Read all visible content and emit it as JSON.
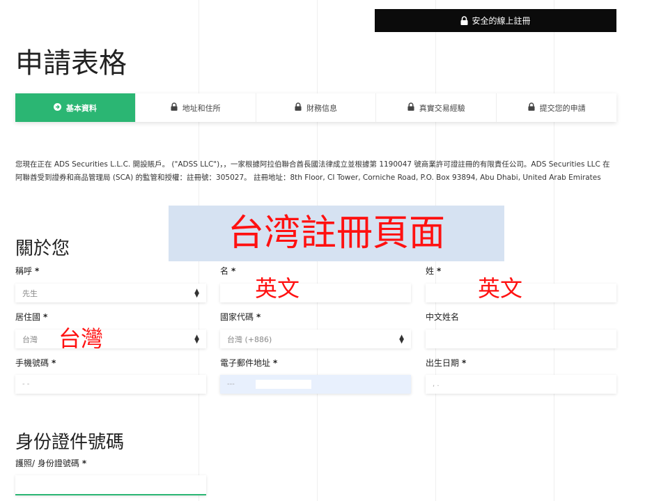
{
  "secure": {
    "label": "安全的線上註冊",
    "icon": "lock-icon"
  },
  "page": {
    "title": "申請表格"
  },
  "steps": [
    {
      "label": "基本資料",
      "icon": "arrow-circle-icon",
      "active": true
    },
    {
      "label": "地址和住所",
      "icon": "lock-icon",
      "active": false
    },
    {
      "label": "財務信息",
      "icon": "lock-icon",
      "active": false
    },
    {
      "label": "真實交易經驗",
      "icon": "lock-icon",
      "active": false
    },
    {
      "label": "提交您的申請",
      "icon": "lock-icon",
      "active": false
    }
  ],
  "intro": "您現在正在 ADS Securities L.L.C. 開設賬戶。 (\"ADSS LLC\")，，一家根據阿拉伯聯合酋長國法律成立並根據第 1190047 號商業許可證註冊的有限責任公司。ADS Securities LLC 在阿聯酋受到證券和商品管理局 (SCA) 的監管和授權：註冊號：305027。 註冊地址：8th Floor, CI Tower, Corniche Road, P.O. Box 93894, Abu Dhabi, United Arab Emirates",
  "overlay": {
    "text": "台湾註冊頁面",
    "color": "#ff1111"
  },
  "about": {
    "heading": "關於您",
    "title": {
      "label": "稱呼",
      "value": "先生"
    },
    "first_name": {
      "label": "名",
      "value": "",
      "annotation": "英文"
    },
    "last_name": {
      "label": "姓",
      "value": "",
      "annotation": "英文"
    },
    "country": {
      "label": "居住國",
      "value": "台灣",
      "annotation": "台灣"
    },
    "country_code": {
      "label": "國家代碼",
      "value": "台灣 (+886)"
    },
    "chinese_name": {
      "label": "中文姓名",
      "value": ""
    },
    "mobile": {
      "label": "手機號碼",
      "value": "- -"
    },
    "email": {
      "label": "電子郵件地址",
      "value": "---"
    },
    "dob": {
      "label": "出生日期",
      "value": ", ."
    }
  },
  "identity": {
    "heading": "身份證件號碼",
    "passport": {
      "label": "護照/ 身份證號碼",
      "value": ""
    }
  },
  "required_mark": "*",
  "colors": {
    "accent": "#2bb673",
    "dark": "#0b0b0b",
    "annotation": "#ff1111"
  }
}
